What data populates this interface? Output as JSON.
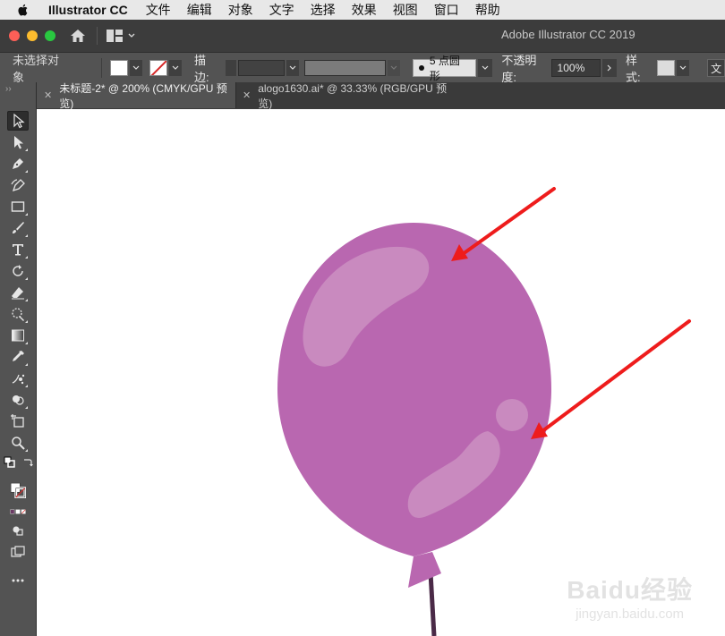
{
  "menubar": {
    "app_name": "Illustrator CC",
    "items": [
      "文件",
      "编辑",
      "对象",
      "文字",
      "选择",
      "效果",
      "视图",
      "窗口",
      "帮助"
    ]
  },
  "window": {
    "title": "Adobe Illustrator CC 2019"
  },
  "control_bar": {
    "selection_label": "未选择对象",
    "stroke_label": "描边:",
    "brush_profile": "5 点圆形",
    "opacity_label": "不透明度:",
    "opacity_value": "100%",
    "style_label": "样式:",
    "overflow_label": "文"
  },
  "tabs": [
    {
      "label": "未标题-2* @ 200% (CMYK/GPU 预览)",
      "active": true
    },
    {
      "label": "alogo1630.ai* @ 33.33% (RGB/GPU 预览)",
      "active": false
    }
  ],
  "colors": {
    "balloon_fill": "#b967b0",
    "balloon_highlight": "#c98abf",
    "string": "#4a2a47",
    "arrow": "#ee1c1c"
  },
  "watermark": {
    "logo": "Baidu经验",
    "url": "jingyan.baidu.com"
  }
}
